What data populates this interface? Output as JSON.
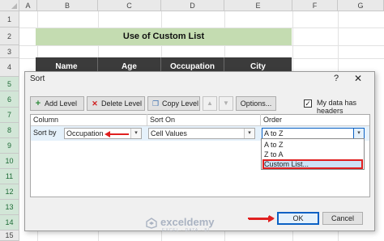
{
  "sheet": {
    "columns": [
      "A",
      "B",
      "C",
      "D",
      "E",
      "F",
      "G"
    ],
    "rows": [
      "1",
      "2",
      "3",
      "4",
      "5",
      "6",
      "7",
      "8",
      "9",
      "10",
      "11",
      "12",
      "13",
      "14",
      "15"
    ],
    "title": "Use of Custom List",
    "headers": [
      "Name",
      "Age",
      "Occupation",
      "City"
    ]
  },
  "dialog": {
    "title": "Sort",
    "help": "?",
    "close": "✕",
    "toolbar": {
      "add_level": "Add Level",
      "delete_level": "Delete Level",
      "copy_level": "Copy Level",
      "move_up": "▲",
      "move_down": "▼",
      "options": "Options..."
    },
    "has_headers_label": "My data has headers",
    "has_headers_checked": "✓",
    "columns": {
      "column": "Column",
      "sort_on": "Sort On",
      "order": "Order"
    },
    "row": {
      "label": "Sort by",
      "column_value": "Occupation",
      "sort_on_value": "Cell Values",
      "order_value": "A to Z"
    },
    "order_options": [
      "A to Z",
      "Z to A",
      "Custom List..."
    ],
    "ok": "OK",
    "cancel": "Cancel"
  },
  "watermark": {
    "name": "exceldemy",
    "sub": "EXCEL · DATA · BI"
  },
  "colors": {
    "selected_row_header": "#d2e6d7",
    "title_band": "#c4dcb1",
    "header_band": "#3b3b3b",
    "annotation_red": "#e02020",
    "ok_border": "#0b61c4"
  }
}
